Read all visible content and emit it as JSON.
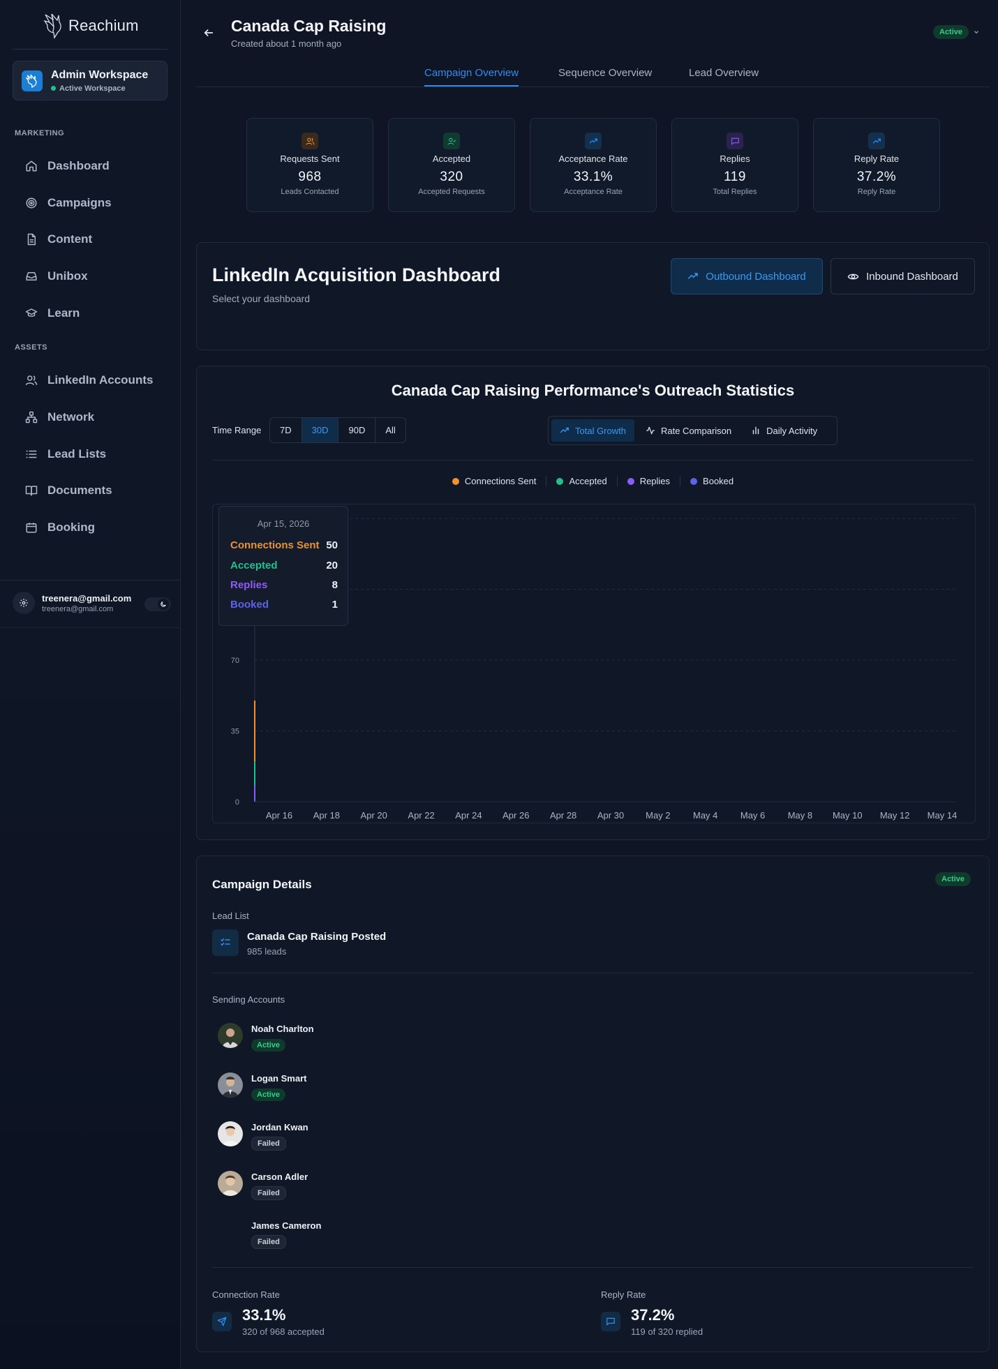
{
  "app": {
    "name": "Reachium"
  },
  "workspace": {
    "name": "Admin Workspace",
    "status": "Active Workspace"
  },
  "sidebar": {
    "sections": [
      "MARKETING",
      "ASSETS"
    ],
    "marketing_items": [
      {
        "label": "Dashboard",
        "icon": "home-icon"
      },
      {
        "label": "Campaigns",
        "icon": "target-icon"
      },
      {
        "label": "Content",
        "icon": "document-icon"
      },
      {
        "label": "Unibox",
        "icon": "inbox-icon"
      },
      {
        "label": "Learn",
        "icon": "graduation-cap-icon"
      }
    ],
    "asset_items": [
      {
        "label": "LinkedIn Accounts",
        "icon": "users-icon"
      },
      {
        "label": "Network",
        "icon": "network-icon"
      },
      {
        "label": "Lead Lists",
        "icon": "list-icon"
      },
      {
        "label": "Documents",
        "icon": "book-icon"
      },
      {
        "label": "Booking",
        "icon": "calendar-icon"
      }
    ],
    "user": {
      "name": "treenera@gmail.com",
      "email": "treenera@gmail.com"
    }
  },
  "header": {
    "title": "Canada Cap Raising",
    "subtitle": "Created about 1 month ago",
    "status": "Active"
  },
  "tabs": [
    "Campaign Overview",
    "Sequence Overview",
    "Lead Overview"
  ],
  "stats": [
    {
      "label": "Requests Sent",
      "value": "968",
      "sub": "Leads Contacted",
      "icon": "users-icon",
      "color": "#e8913a"
    },
    {
      "label": "Accepted",
      "value": "320",
      "sub": "Accepted Requests",
      "icon": "user-check-icon",
      "color": "#22c08a"
    },
    {
      "label": "Acceptance Rate",
      "value": "33.1%",
      "sub": "Acceptance Rate",
      "icon": "trending-up-icon",
      "color": "#2f8df0"
    },
    {
      "label": "Replies",
      "value": "119",
      "sub": "Total Replies",
      "icon": "message-icon",
      "color": "#8b5cf6"
    },
    {
      "label": "Reply Rate",
      "value": "37.2%",
      "sub": "Reply Rate",
      "icon": "trending-up-icon",
      "color": "#2f8df0"
    }
  ],
  "dashboard": {
    "title": "LinkedIn Acquisition Dashboard",
    "subtitle": "Select your dashboard",
    "outbound_label": "Outbound Dashboard",
    "inbound_label": "Inbound Dashboard"
  },
  "outreach": {
    "title": "Canada Cap Raising Performance's Outreach Statistics",
    "time_range_label": "Time Range",
    "time_ranges": [
      "7D",
      "30D",
      "90D",
      "All"
    ],
    "active_range": "30D",
    "views": [
      "Total Growth",
      "Rate Comparison",
      "Daily Activity"
    ],
    "active_view": "Total Growth"
  },
  "chart_data": {
    "type": "line",
    "title": "",
    "x": [
      "Apr 15, 2026"
    ],
    "x_ticks": [
      "Apr 16",
      "Apr 18",
      "Apr 20",
      "Apr 22",
      "Apr 24",
      "Apr 26",
      "Apr 28",
      "Apr 30",
      "May 2",
      "May 4",
      "May 6",
      "May 8",
      "May 10",
      "May 12",
      "May 14"
    ],
    "y_ticks": [
      0,
      35,
      70
    ],
    "ylim": [
      0,
      140
    ],
    "grid": true,
    "legend": "top-center",
    "series": [
      {
        "name": "Connections Sent",
        "color": "#f0922e",
        "values": [
          50
        ]
      },
      {
        "name": "Accepted",
        "color": "#22c08a",
        "values": [
          20
        ]
      },
      {
        "name": "Replies",
        "color": "#8b5cf6",
        "values": [
          8
        ]
      },
      {
        "name": "Booked",
        "color": "#5b63e6",
        "values": [
          1
        ]
      }
    ],
    "tooltip": {
      "date": "Apr 15, 2026",
      "rows": [
        {
          "label": "Connections Sent",
          "value": "50",
          "color": "#e8913a"
        },
        {
          "label": "Accepted",
          "value": "20",
          "color": "#22c08a"
        },
        {
          "label": "Replies",
          "value": "8",
          "color": "#8b5cf6"
        },
        {
          "label": "Booked",
          "value": "1",
          "color": "#5b63e6"
        }
      ]
    }
  },
  "campaign_details": {
    "title": "Campaign Details",
    "status": "Active",
    "lead_list_label": "Lead List",
    "lead_list": {
      "name": "Canada Cap Raising Posted",
      "count": "985 leads"
    },
    "sending_accounts_label": "Sending Accounts",
    "accounts": [
      {
        "name": "Noah Charlton",
        "status": "Active"
      },
      {
        "name": "Logan Smart",
        "status": "Active"
      },
      {
        "name": "Jordan Kwan",
        "status": "Failed"
      },
      {
        "name": "Carson Adler",
        "status": "Failed"
      },
      {
        "name": "James Cameron",
        "status": "Failed"
      }
    ],
    "connection_rate": {
      "label": "Connection Rate",
      "value": "33.1%",
      "sub": "320 of 968 accepted"
    },
    "reply_rate": {
      "label": "Reply Rate",
      "value": "37.2%",
      "sub": "119 of 320 replied"
    }
  }
}
